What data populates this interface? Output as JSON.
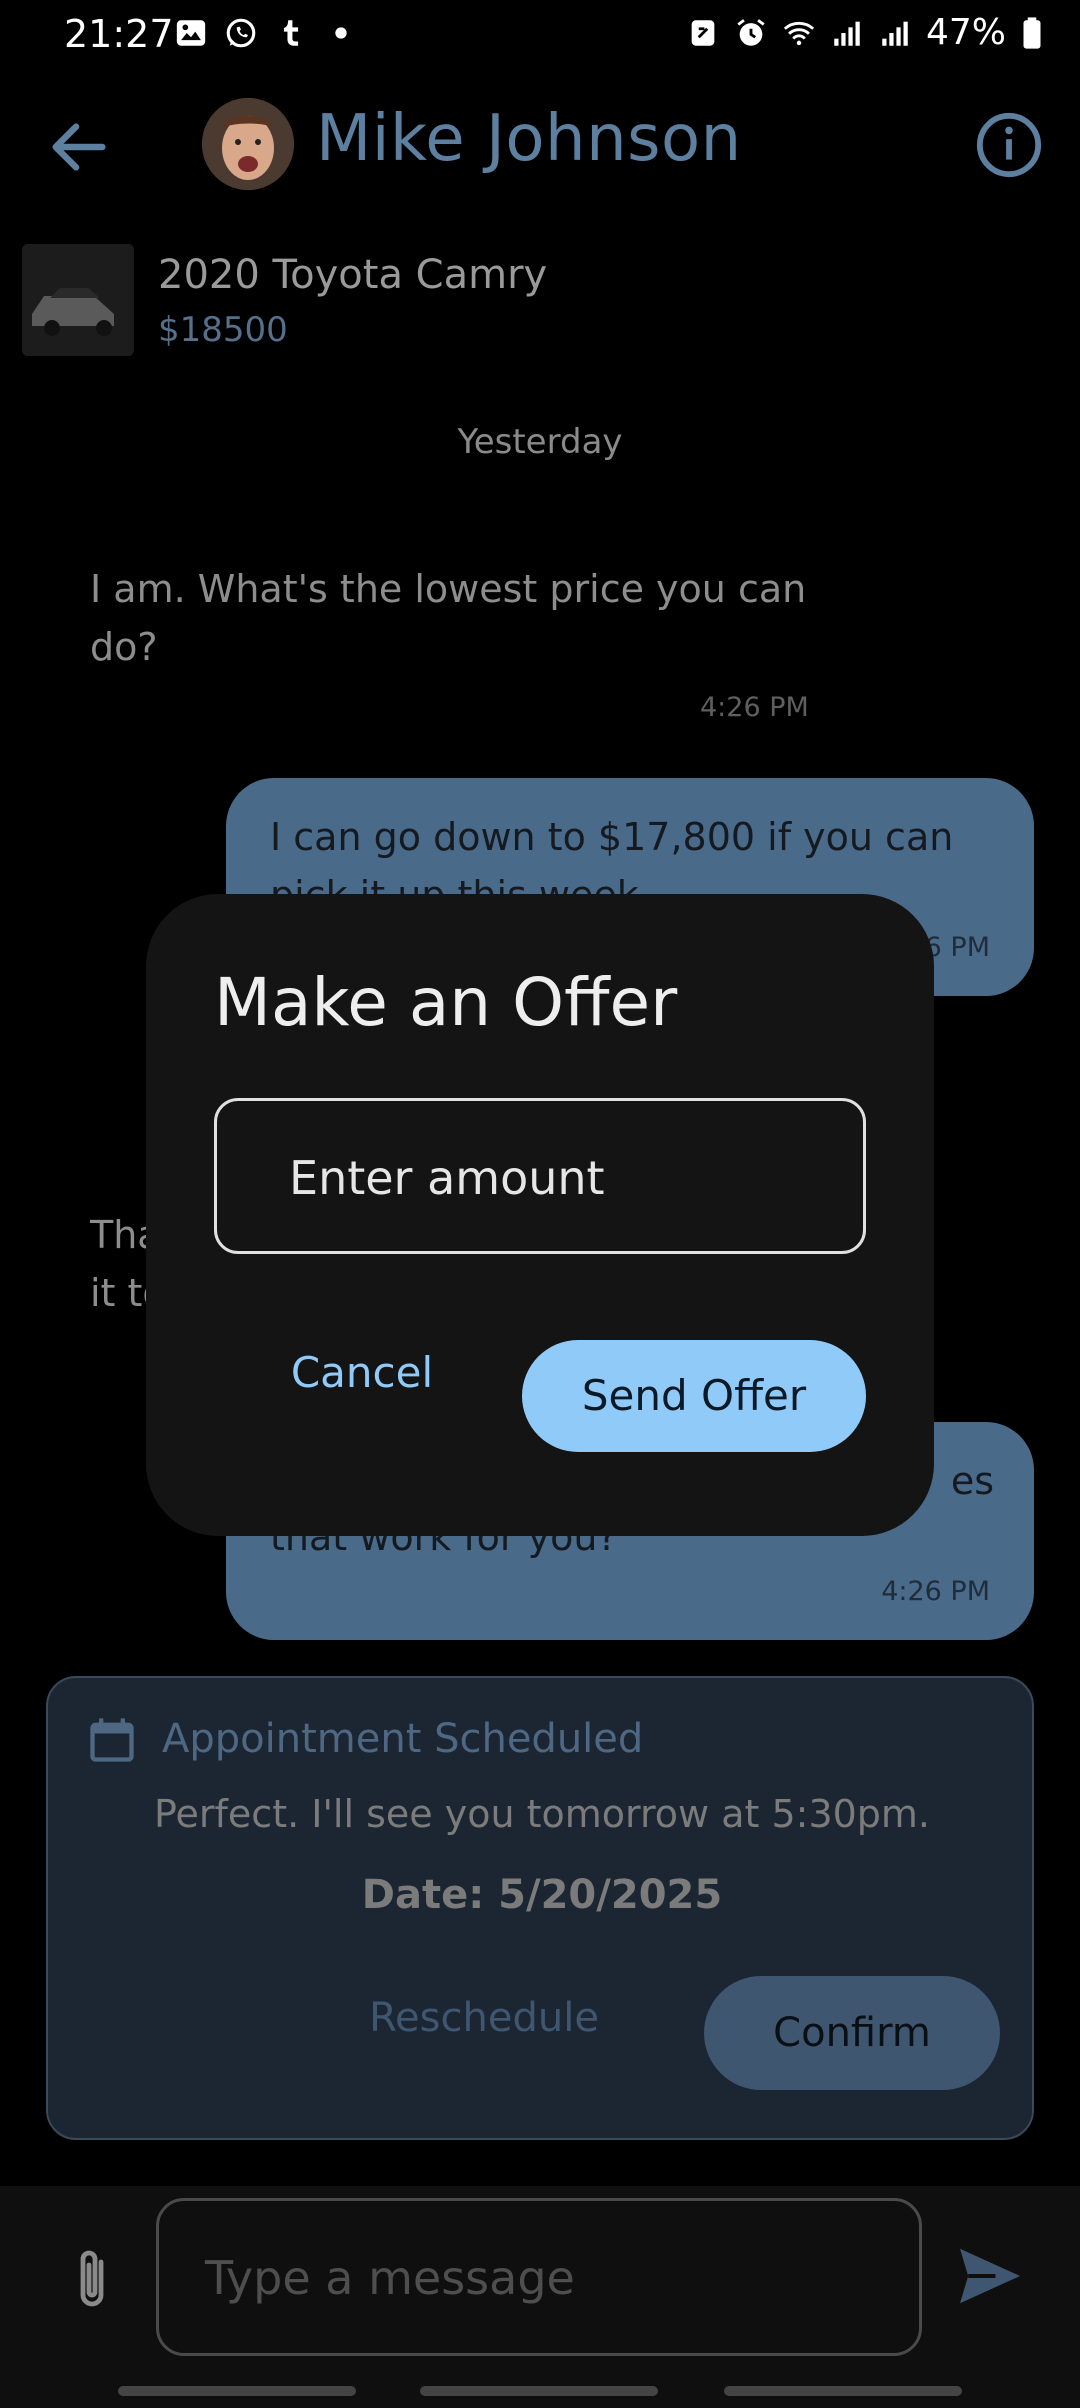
{
  "status_bar": {
    "time": "21:27",
    "battery": "47%",
    "left_icons": [
      "gallery-icon",
      "whatsapp-icon",
      "tumblr-icon",
      "dot-icon"
    ],
    "right_icons": [
      "nfc-icon",
      "alarm-icon",
      "wifi-icon",
      "signal-icon",
      "signal-icon",
      "battery-icon"
    ]
  },
  "header": {
    "contact_name": "Mike Johnson"
  },
  "listing": {
    "title": "2020 Toyota Camry",
    "price": "$18500"
  },
  "chat": {
    "date_separator": "Yesterday",
    "messages": [
      {
        "direction": "incoming",
        "text": "I am. What's the lowest price you can do?",
        "time": "4:26 PM"
      },
      {
        "direction": "outgoing",
        "text": "I can go down to $17,800 if you can pick it up this week.",
        "time": "4:26 PM"
      },
      {
        "direction": "incoming",
        "text": "Tha",
        "text2": "it to",
        "time": ""
      },
      {
        "direction": "outgoing",
        "text": "es",
        "text2": "that work for you?",
        "time": "4:26 PM"
      }
    ]
  },
  "appointment": {
    "title": "Appointment Scheduled",
    "message": "Perfect. I'll see you tomorrow at 5:30pm.",
    "date": "Date: 5/20/2025",
    "reschedule_label": "Reschedule",
    "confirm_label": "Confirm"
  },
  "composer": {
    "placeholder": "Type a message"
  },
  "dialog": {
    "title": "Make an Offer",
    "amount_placeholder": "Enter amount",
    "cancel_label": "Cancel",
    "send_label": "Send Offer"
  },
  "colors": {
    "accent": "#90caf9",
    "header_text": "#5d7fa0",
    "bubble": "#4a6a8a",
    "card": "#1b2632"
  }
}
